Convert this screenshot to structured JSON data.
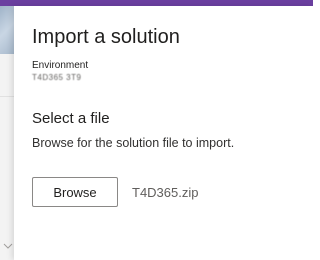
{
  "header": {
    "accent_color": "#6b3fa0"
  },
  "panel": {
    "title": "Import a solution",
    "environment_label": "Environment",
    "environment_value": "T4D365 3T9"
  },
  "file_section": {
    "title": "Select a file",
    "description": "Browse for the solution file to import.",
    "browse_label": "Browse",
    "file_name": "T4D365.zip"
  },
  "backdrop": {
    "chevron_icon": "chevron-down-icon"
  }
}
